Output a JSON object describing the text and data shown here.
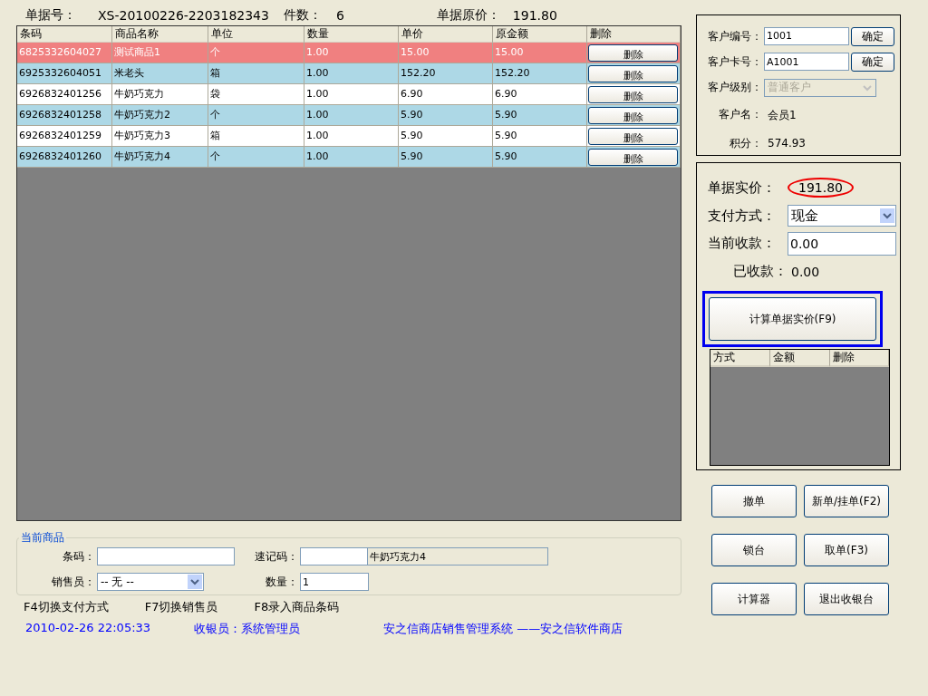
{
  "header": {
    "bill_no_label": "单据号：",
    "bill_no": "XS-20100226-2203182343",
    "count_label": "件数：",
    "count": "6",
    "orig_price_label": "单据原价：",
    "orig_price": "191.80"
  },
  "table": {
    "columns": [
      "条码",
      "商品名称",
      "单位",
      "数量",
      "单价",
      "原金额",
      "删除"
    ],
    "rows": [
      {
        "cells": [
          "6825332604027",
          "测试商品1",
          "个",
          "1.00",
          "15.00",
          "15.00"
        ],
        "action": "删除",
        "selected": true
      },
      {
        "cells": [
          "6925332604051",
          "米老头",
          "箱",
          "1.00",
          "152.20",
          "152.20"
        ],
        "action": "删除",
        "selected": false
      },
      {
        "cells": [
          "6926832401256",
          "牛奶巧克力",
          "袋",
          "1.00",
          "6.90",
          "6.90"
        ],
        "action": "删除",
        "selected": false
      },
      {
        "cells": [
          "6926832401258",
          "牛奶巧克力2",
          "个",
          "1.00",
          "5.90",
          "5.90"
        ],
        "action": "删除",
        "selected": false
      },
      {
        "cells": [
          "6926832401259",
          "牛奶巧克力3",
          "箱",
          "1.00",
          "5.90",
          "5.90"
        ],
        "action": "删除",
        "selected": false
      },
      {
        "cells": [
          "6926832401260",
          "牛奶巧克力4",
          "个",
          "1.00",
          "5.90",
          "5.90"
        ],
        "action": "删除",
        "selected": false
      }
    ]
  },
  "customer": {
    "fields": [
      {
        "kind": "input",
        "label": "客户编号：",
        "value": "1001",
        "button": "确定"
      },
      {
        "kind": "input",
        "label": "客户卡号：",
        "value": "A1001",
        "button": "确定"
      },
      {
        "kind": "select",
        "label": "客户级别：",
        "value": "普通客户",
        "disabled": true
      },
      {
        "kind": "text",
        "label": "客户名：",
        "value": "会员1"
      },
      {
        "kind": "text",
        "label": "积分：",
        "value": "574.93"
      }
    ]
  },
  "payment": {
    "actual_label": "单据实价：",
    "actual": "191.80",
    "method_label": "支付方式：",
    "method": "现金",
    "current_label": "当前收款：",
    "current": "0.00",
    "received_label": "已收款：",
    "received": "0.00",
    "calc_button": "计算单据实价(F9)",
    "list_columns": [
      "方式",
      "金额",
      "删除"
    ]
  },
  "actions": [
    {
      "label": "撤单",
      "disabled": false
    },
    {
      "label": "新单/挂单(F2)",
      "disabled": false
    },
    {
      "label": "锁台",
      "disabled": false
    },
    {
      "label": "取单(F3)",
      "disabled": false
    },
    {
      "label": "计算器",
      "disabled": false
    },
    {
      "label": "退出收银台",
      "disabled": false
    }
  ],
  "current_item": {
    "title": "当前商品",
    "barcode_label": "条码：",
    "shortcode_label": "速记码：",
    "name": "牛奶巧克力4",
    "seller_label": "销售员：",
    "seller": "-- 无 --",
    "qty_label": "数量：",
    "qty": "1"
  },
  "hotkeys": [
    "F4切换支付方式",
    "F7切换销售员",
    "F8录入商品条码"
  ],
  "status_bar": [
    "2010-02-26 22:05:33",
    "收银员：系统管理员",
    "安之信商店销售管理系统 ——安之信软件商店"
  ]
}
